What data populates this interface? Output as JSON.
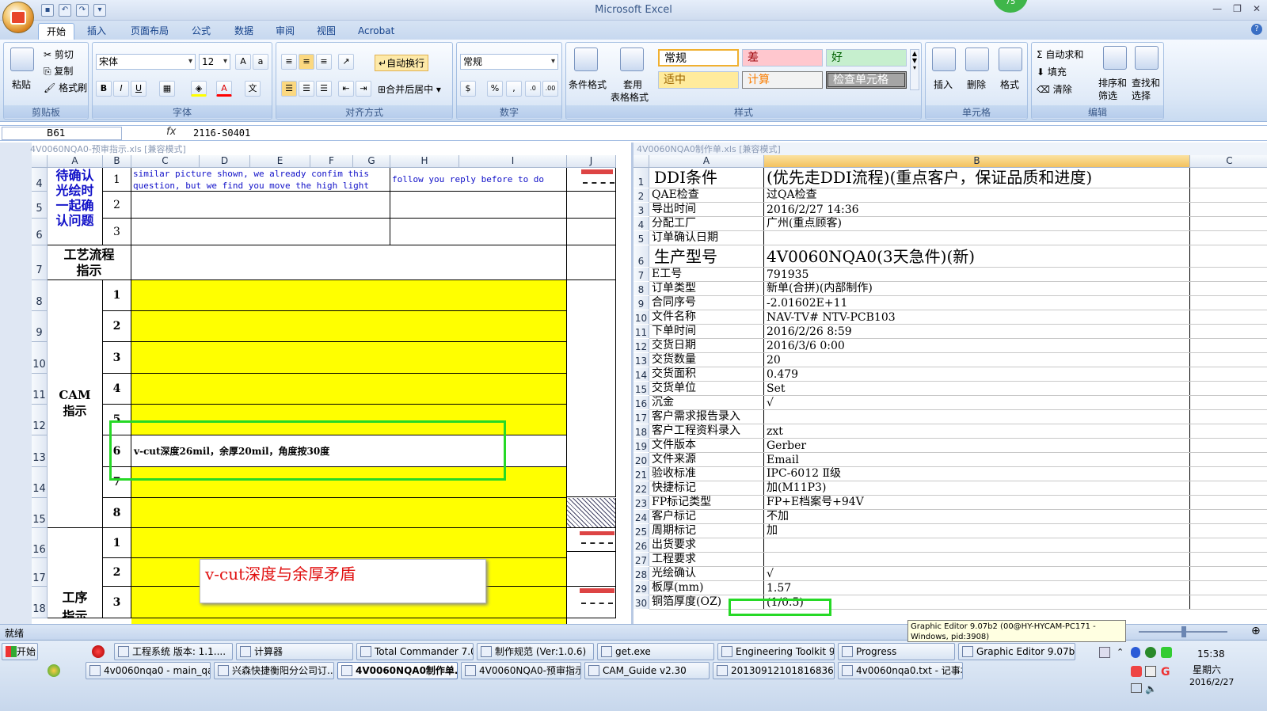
{
  "app": {
    "title": "Microsoft Excel",
    "badge": "75"
  },
  "tabs": [
    "开始",
    "插入",
    "页面布局",
    "公式",
    "数据",
    "审阅",
    "视图",
    "Acrobat"
  ],
  "ribbon": {
    "clipboard": {
      "paste": "粘贴",
      "cut": "剪切",
      "copy": "复制",
      "format_painter": "格式刷",
      "label": "剪贴板"
    },
    "font": {
      "name": "宋体",
      "size": "12",
      "bold": "B",
      "italic": "I",
      "underline": "U",
      "label": "字体"
    },
    "align": {
      "wrap": "自动换行",
      "merge": "合并后居中",
      "label": "对齐方式"
    },
    "number": {
      "format": "常规",
      "percent": "%",
      "comma": ",",
      "label": "数字"
    },
    "styles": {
      "cond": "条件格式",
      "table1": "套用",
      "table2": "表格格式",
      "label": "样式",
      "items": [
        {
          "t": "常规",
          "bg": "#ffffff"
        },
        {
          "t": "差",
          "bg": "#ffc7ce",
          "c": "#9c0006"
        },
        {
          "t": "好",
          "bg": "#c6efce",
          "c": "#006100"
        },
        {
          "t": "适中",
          "bg": "#ffeb9c",
          "c": "#9c6500"
        },
        {
          "t": "计算",
          "bg": "#f2f2f2",
          "c": "#fa7d00"
        },
        {
          "t": "检查单元格",
          "bg": "#a5a5a5",
          "c": "#ffffff"
        }
      ]
    },
    "cells": {
      "insert": "插入",
      "delete": "删除",
      "format": "格式",
      "label": "单元格"
    },
    "editing": {
      "autosum": "自动求和",
      "fill": "填充",
      "clear": "清除",
      "sort1": "排序和",
      "sort2": "筛选",
      "find1": "查找和",
      "find2": "选择",
      "label": "编辑"
    }
  },
  "formula": {
    "name": "B61",
    "fx": "fx",
    "value": "2116-S0401"
  },
  "left": {
    "title": "4V0060NQA0-预审指示.xls  [兼容模式]",
    "cols": [
      "A",
      "B",
      "C",
      "D",
      "E",
      "F",
      "G",
      "H",
      "I",
      "J"
    ],
    "confirm_label": "待确认光绘时一起确认问题",
    "row4_text1": "similar picture shown, we already confim this",
    "row4_text2": "question, but we find you move the high light",
    "row4_text3": "follow you reply before to do",
    "process_label": "工艺流程指示",
    "cam_label": "CAM指示",
    "cam_row6": "v-cut深度26mil，余厚20mil，角度按30度",
    "proc_label": "工序指示",
    "nums": [
      "1",
      "2",
      "3",
      "1",
      "2",
      "3",
      "4",
      "5",
      "6",
      "7",
      "8",
      "1",
      "2",
      "3"
    ],
    "rows": [
      "4",
      "5",
      "6",
      "7",
      "8",
      "9",
      "10",
      "11",
      "12",
      "13",
      "14",
      "15",
      "16",
      "17",
      "18"
    ],
    "callout": "v-cut深度与余厚矛盾"
  },
  "right": {
    "title": "4V0060NQA0制作单.xls  [兼容模式]",
    "cols": [
      "A",
      "B",
      "C"
    ],
    "rows": [
      {
        "n": "1",
        "a": "DDI条件",
        "b": "(优先走DDI流程)(重点客户，保证品质和进度)"
      },
      {
        "n": "2",
        "a": "QAE检查",
        "b": "过QA检查"
      },
      {
        "n": "3",
        "a": "导出时间",
        "b": "2016/2/27 14:36"
      },
      {
        "n": "4",
        "a": "分配工厂",
        "b": "广州(重点顾客)"
      },
      {
        "n": "5",
        "a": "订单确认日期",
        "b": ""
      },
      {
        "n": "6",
        "a": "生产型号",
        "b": "4V0060NQA0(3天急件)(新)"
      },
      {
        "n": "7",
        "a": "E工号",
        "b": "791935"
      },
      {
        "n": "8",
        "a": "订单类型",
        "b": "新单(合拼)(内部制作)"
      },
      {
        "n": "9",
        "a": "合同序号",
        "b": "-2.01602E+11"
      },
      {
        "n": "10",
        "a": "文件名称",
        "b": "NAV-TV# NTV-PCB103"
      },
      {
        "n": "11",
        "a": "下单时间",
        "b": "2016/2/26 8:59"
      },
      {
        "n": "12",
        "a": "交货日期",
        "b": "2016/3/6 0:00"
      },
      {
        "n": "13",
        "a": "交货数量",
        "b": "20"
      },
      {
        "n": "14",
        "a": "交货面积",
        "b": "0.479"
      },
      {
        "n": "15",
        "a": "交货单位",
        "b": "Set"
      },
      {
        "n": "16",
        "a": "沉金",
        "b": "√"
      },
      {
        "n": "17",
        "a": "客户需求报告录入",
        "b": ""
      },
      {
        "n": "18",
        "a": "客户工程资料录入",
        "b": "zxt"
      },
      {
        "n": "19",
        "a": "文件版本",
        "b": "Gerber"
      },
      {
        "n": "20",
        "a": "文件来源",
        "b": "Email"
      },
      {
        "n": "21",
        "a": "验收标准",
        "b": "IPC-6012 Ⅱ级"
      },
      {
        "n": "22",
        "a": "快捷标记",
        "b": "加(M11P3)"
      },
      {
        "n": "23",
        "a": "FP标记类型",
        "b": "FP+E档案号+94V"
      },
      {
        "n": "24",
        "a": "客户标记",
        "b": "不加"
      },
      {
        "n": "25",
        "a": "周期标记",
        "b": "加"
      },
      {
        "n": "26",
        "a": "出货要求",
        "b": ""
      },
      {
        "n": "27",
        "a": "工程要求",
        "b": ""
      },
      {
        "n": "28",
        "a": "光绘确认",
        "b": "√"
      },
      {
        "n": "29",
        "a": "板厚(mm)",
        "b": "1.57"
      },
      {
        "n": "30",
        "a": "铜箔厚度(OZ)",
        "b": "(1/0.5)"
      }
    ]
  },
  "status": {
    "ready": "就绪"
  },
  "tooltip": "Graphic Editor 9.07b2 (00@HY-HYCAM-PC171 - Windows, pid:3908)",
  "taskbar": {
    "start": "开始",
    "row1": [
      "工程系统  版本: 1.1....",
      "计算器",
      "Total Commander 7.0 p...",
      "制作规范 (Ver:1.0.6)",
      "get.exe",
      "Engineering Toolkit 9.0...",
      "Progress",
      "Graphic Editor 9.07b2 (..."
    ],
    "row2": [
      "4v0060nqa0 - main_qa",
      "兴森快捷衡阳分公司订...",
      "4V0060NQA0制作单.x...",
      "4V0060NQA0-预审指示....",
      "CAM_Guide v2.30",
      "20130912101816836.rtf...",
      "4v0060nqa0.txt - 记事本"
    ],
    "time": "15:38",
    "weekday": "星期六",
    "date": "2016/2/27"
  }
}
